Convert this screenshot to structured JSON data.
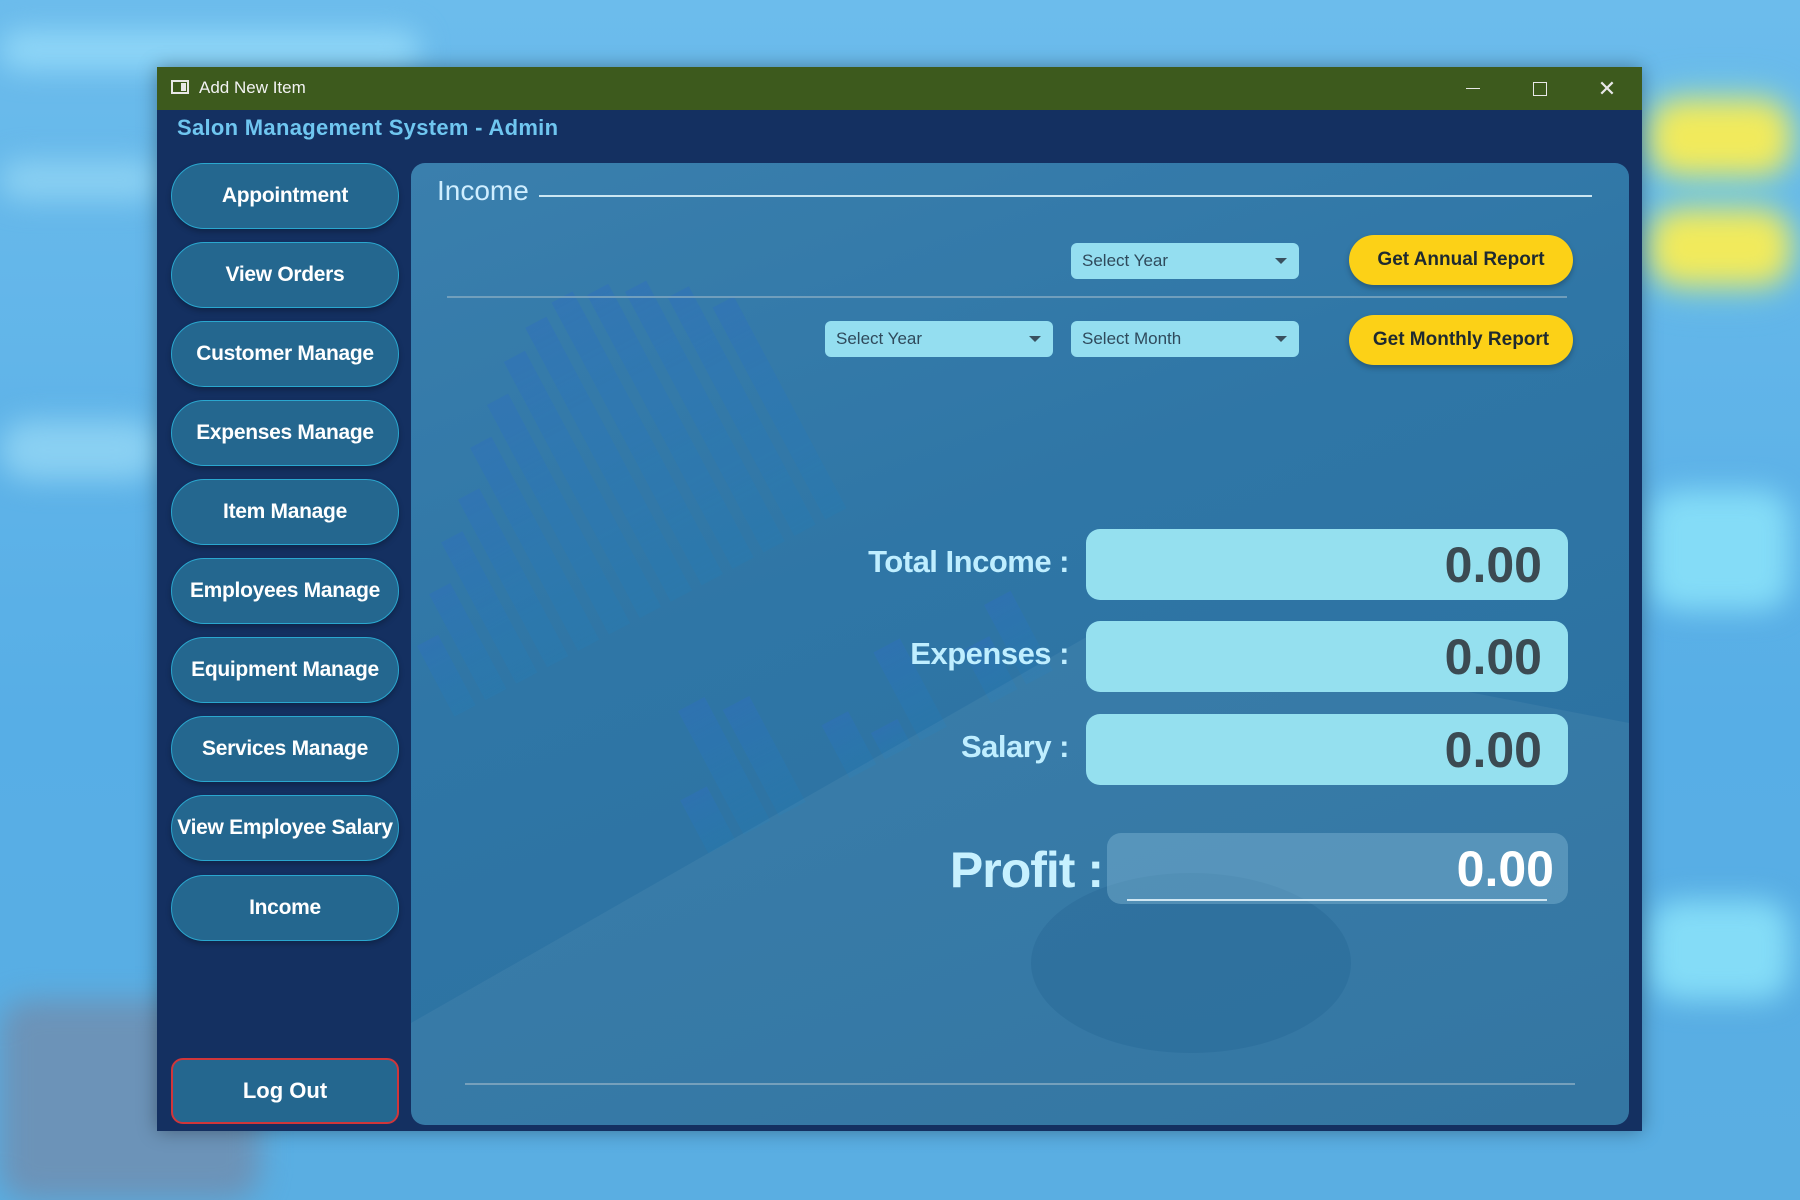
{
  "window": {
    "title": "Add New Item",
    "app_header": "Salon Management System  -  Admin"
  },
  "sidebar": {
    "items": [
      {
        "label": "Appointment"
      },
      {
        "label": "View Orders"
      },
      {
        "label": "Customer Manage"
      },
      {
        "label": "Expenses Manage"
      },
      {
        "label": "Item Manage"
      },
      {
        "label": "Employees Manage"
      },
      {
        "label": "Equipment Manage"
      },
      {
        "label": "Services Manage"
      },
      {
        "label": "View Employee Salary"
      },
      {
        "label": "Income"
      }
    ],
    "logout_label": "Log Out"
  },
  "income": {
    "title": "Income",
    "annual": {
      "year_select": "Select Year",
      "button": "Get Annual Report"
    },
    "monthly": {
      "year_select": "Select Year",
      "month_select": "Select Month",
      "button": "Get Monthly Report"
    },
    "stats": {
      "total_income_label": "Total Income :",
      "total_income_value": "0.00",
      "expenses_label": "Expenses :",
      "expenses_value": "0.00",
      "salary_label": "Salary :",
      "salary_value": "0.00",
      "profit_label": "Profit :",
      "profit_value": "0.00"
    }
  },
  "colors": {
    "titlebar": "#3d5a1d",
    "window_bg": "#143061",
    "accent_yellow": "#fcd117",
    "field_bg": "#95e0ef"
  }
}
